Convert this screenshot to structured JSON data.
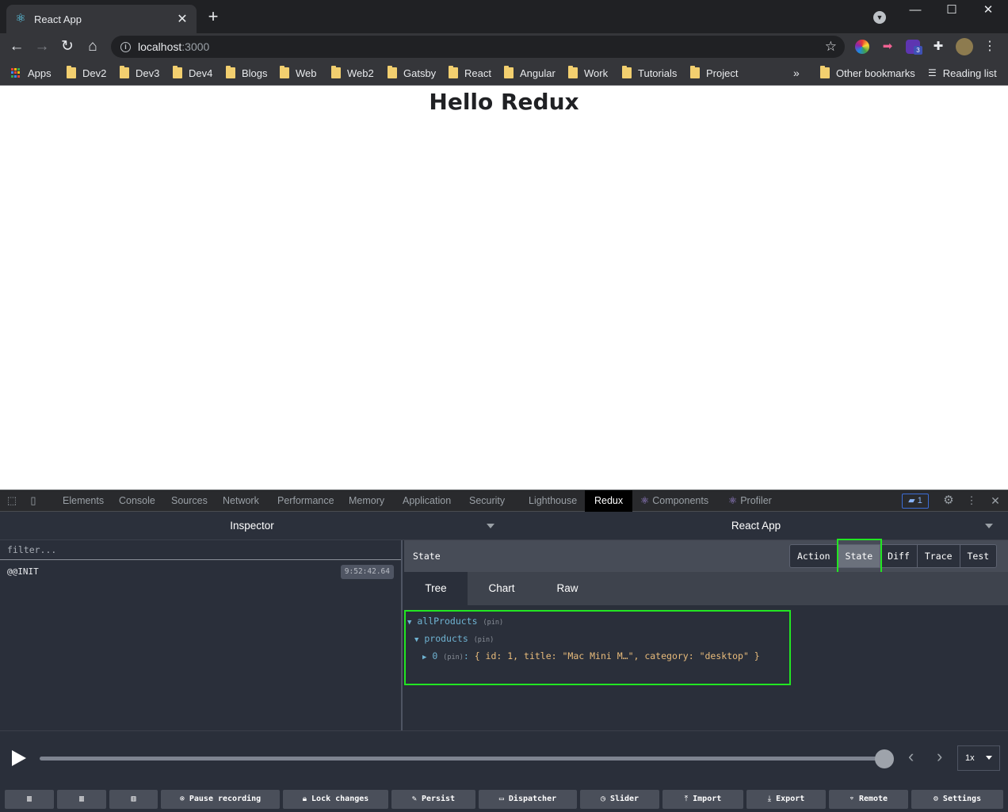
{
  "browser": {
    "tab_title": "React App",
    "url_host": "localhost",
    "url_port": ":3000",
    "extension_badge": "3"
  },
  "bookmarks": {
    "apps": "Apps",
    "folders": [
      "Dev2",
      "Dev3",
      "Dev4",
      "Blogs",
      "Web",
      "Web2",
      "Gatsby",
      "React",
      "Angular",
      "Work",
      "Tutorials",
      "Project"
    ],
    "overflow": "»",
    "other": "Other bookmarks",
    "reading_list": "Reading list"
  },
  "page": {
    "heading": "Hello Redux"
  },
  "devtools": {
    "tabs": [
      "Elements",
      "Console",
      "Sources",
      "Network",
      "Performance",
      "Memory",
      "Application",
      "Security",
      "Lighthouse",
      "Redux",
      "Components",
      "Profiler"
    ],
    "active_tab": "Redux",
    "message_count": "1"
  },
  "redux": {
    "left_title": "Inspector",
    "right_title": "React App",
    "filter_placeholder": "filter...",
    "actions": [
      {
        "name": "@@INIT",
        "time": "9:52:42.64"
      }
    ],
    "state_label": "State",
    "modes": [
      "Action",
      "State",
      "Diff",
      "Trace",
      "Test"
    ],
    "selected_mode": "State",
    "subtabs": [
      "Tree",
      "Chart",
      "Raw"
    ],
    "selected_subtab": "Tree",
    "tree": {
      "root_key": "allProducts",
      "child_key": "products",
      "item_index": "0",
      "pin": "(pin)",
      "item_preview": "{ id: 1, title: \"Mac Mini M…\", category: \"desktop\" }"
    },
    "slider": {
      "position": 1.0,
      "speed": "1x"
    },
    "buttons": {
      "pause": "Pause recording",
      "lock": "Lock changes",
      "persist": "Persist",
      "dispatcher": "Dispatcher",
      "slider": "Slider",
      "import": "Import",
      "export": "Export",
      "remote": "Remote",
      "settings": "Settings"
    }
  },
  "colors": {
    "highlight": "#22e622",
    "tree_key": "#6fb3d2",
    "tree_value": "#e8bb7b"
  }
}
